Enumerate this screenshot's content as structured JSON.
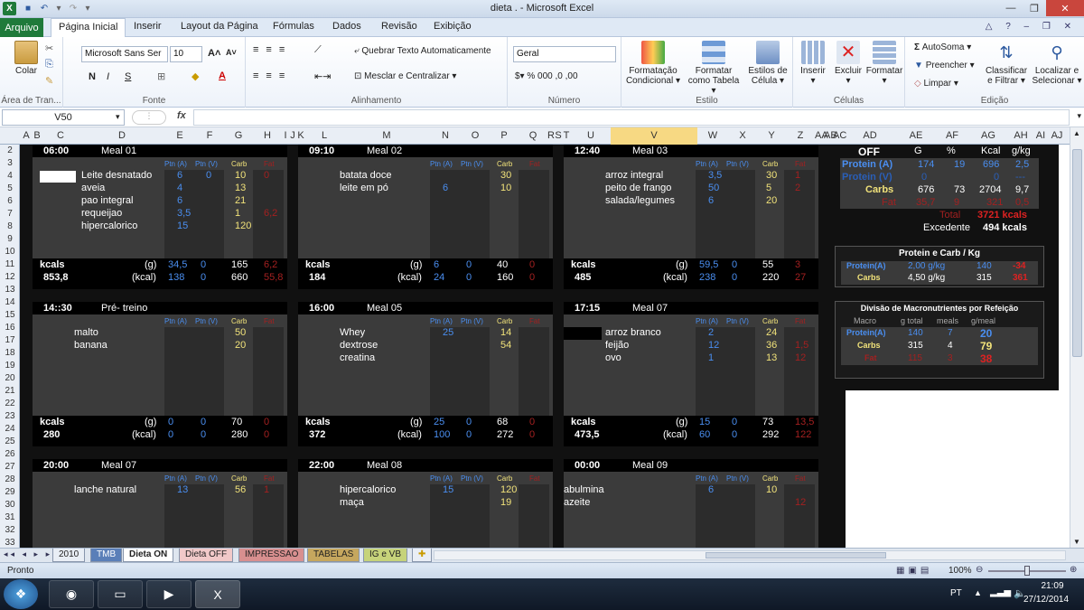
{
  "window": {
    "title": "dieta . - Microsoft Excel"
  },
  "tabs": [
    "Arquivo",
    "Página Inicial",
    "Inserir",
    "Layout da Página",
    "Fórmulas",
    "Dados",
    "Revisão",
    "Exibição"
  ],
  "ribbon": {
    "colar": "Colar",
    "font_name": "Microsoft Sans Ser",
    "font_size": "10",
    "quebrar": "Quebrar Texto Automaticamente",
    "mesclar": "Mesclar e Centralizar",
    "number_format": "Geral",
    "formatacao_condicional": [
      "Formatação",
      "Condicional"
    ],
    "formatar_tabela": [
      "Formatar",
      "como Tabela"
    ],
    "estilos_celula": [
      "Estilos de",
      "Célula"
    ],
    "inserir": "Inserir",
    "excluir": "Excluir",
    "formatar": "Formatar",
    "autosoma": "AutoSoma",
    "preencher": "Preencher",
    "limpar": "Limpar",
    "classificar": [
      "Classificar",
      "e Filtrar"
    ],
    "localizar": [
      "Localizar e",
      "Selecionar"
    ],
    "groups": [
      "Área de Tran...",
      "Fonte",
      "Alinhamento",
      "Número",
      "Estilo",
      "Células",
      "Edição"
    ],
    "bold": "N",
    "italic": "I",
    "underline": "S"
  },
  "formula_bar": {
    "name_box": "V50",
    "fx": "fx",
    "content": ""
  },
  "columns": [
    "A",
    "B",
    "C",
    "D",
    "E",
    "F",
    "G",
    "H",
    "I",
    "J",
    "K",
    "L",
    "M",
    "N",
    "O",
    "P",
    "Q",
    "R",
    "S",
    "T",
    "U",
    "V",
    "W",
    "X",
    "Y",
    "Z",
    "AA",
    "AB",
    "AC",
    "AD",
    "AE",
    "AF",
    "AG",
    "AH",
    "AI",
    "AJ"
  ],
  "rows": [
    "2",
    "3",
    "4",
    "5",
    "6",
    "7",
    "8",
    "9",
    "10",
    "11",
    "12",
    "13",
    "14",
    "15",
    "16",
    "17",
    "18",
    "19",
    "20",
    "21",
    "22",
    "23",
    "24",
    "25",
    "26",
    "27",
    "28",
    "29",
    "30",
    "31",
    "32",
    "33"
  ],
  "meals": [
    {
      "time": "06:00",
      "name": "Meal 01",
      "items": [
        "Leite desnatado",
        "aveia",
        "pao integral",
        "requeijao",
        "hipercalorico"
      ],
      "ptn_a": [
        "6",
        "4",
        "6",
        "3,5",
        "15"
      ],
      "ptn_v": [
        "0",
        "",
        "",
        "",
        ""
      ],
      "carb": [
        "10",
        "13",
        "21",
        "1",
        "120"
      ],
      "fat": [
        "0",
        "",
        "",
        "6,2",
        ""
      ],
      "g": [
        "34,5",
        "0",
        "165",
        "6,2"
      ],
      "kcal": [
        "138",
        "0",
        "660",
        "55,8"
      ],
      "total": "853,8"
    },
    {
      "time": "09:10",
      "name": "Meal 02",
      "items": [
        "batata doce",
        "leite em pó"
      ],
      "ptn_a": [
        "",
        "6"
      ],
      "ptn_v": [
        "",
        ""
      ],
      "carb": [
        "30",
        "10"
      ],
      "fat": [
        "",
        ""
      ],
      "g": [
        "6",
        "0",
        "40",
        "0"
      ],
      "kcal": [
        "24",
        "0",
        "160",
        "0"
      ],
      "total": "184"
    },
    {
      "time": "12:40",
      "name": "Meal 03",
      "items": [
        "arroz integral",
        "peito de frango",
        "salada/legumes"
      ],
      "ptn_a": [
        "3,5",
        "50",
        "6"
      ],
      "ptn_v": [
        "",
        "",
        ""
      ],
      "carb": [
        "30",
        "5",
        "20"
      ],
      "fat": [
        "1",
        "2",
        ""
      ],
      "g": [
        "59,5",
        "0",
        "55",
        "3"
      ],
      "kcal": [
        "238",
        "0",
        "220",
        "27"
      ],
      "total": "485"
    },
    {
      "time": "14::30",
      "name": "Pré- treino",
      "items": [
        "malto",
        "banana"
      ],
      "ptn_a": [
        "",
        ""
      ],
      "ptn_v": [
        "",
        ""
      ],
      "carb": [
        "50",
        "20"
      ],
      "fat": [
        "",
        ""
      ],
      "g": [
        "0",
        "0",
        "70",
        "0"
      ],
      "kcal": [
        "0",
        "0",
        "280",
        "0"
      ],
      "total": "280"
    },
    {
      "time": "16:00",
      "name": "Meal 05",
      "items": [
        "Whey",
        "dextrose",
        "creatina"
      ],
      "ptn_a": [
        "25",
        "",
        ""
      ],
      "ptn_v": [
        "",
        "",
        ""
      ],
      "carb": [
        "14",
        "54",
        ""
      ],
      "fat": [
        "",
        "",
        ""
      ],
      "g": [
        "25",
        "0",
        "68",
        "0"
      ],
      "kcal": [
        "100",
        "0",
        "272",
        "0"
      ],
      "total": "372"
    },
    {
      "time": "17:15",
      "name": "Meal 07",
      "items": [
        "arroz branco",
        "feijão",
        "ovo"
      ],
      "ptn_a": [
        "2",
        "12",
        "1"
      ],
      "ptn_v": [
        "",
        "",
        ""
      ],
      "carb": [
        "24",
        "36",
        "13"
      ],
      "fat": [
        "",
        "1,5",
        "12"
      ],
      "g": [
        "15",
        "0",
        "73",
        "13,5"
      ],
      "kcal": [
        "60",
        "0",
        "292",
        "122"
      ],
      "total": "473,5"
    },
    {
      "time": "20:00",
      "name": "Meal 07",
      "items": [
        "lanche natural"
      ],
      "ptn_a": [
        "13"
      ],
      "ptn_v": [
        ""
      ],
      "carb": [
        "56"
      ],
      "fat": [
        "1"
      ],
      "total": ""
    },
    {
      "time": "22:00",
      "name": "Meal 08",
      "items": [
        "hipercalorico",
        "maça"
      ],
      "ptn_a": [
        "15",
        ""
      ],
      "ptn_v": [
        "",
        ""
      ],
      "carb": [
        "120",
        "19"
      ],
      "fat": [
        "",
        ""
      ],
      "total": ""
    },
    {
      "time": "00:00",
      "name": "Meal 09",
      "items": [
        "abulmina",
        "azeite"
      ],
      "ptn_a": [
        "6",
        ""
      ],
      "ptn_v": [
        "",
        ""
      ],
      "carb": [
        "10",
        ""
      ],
      "fat": [
        "",
        "12"
      ],
      "total": ""
    }
  ],
  "labels": {
    "ptn_a": "Ptn (A)",
    "ptn_v": "Ptn (V)",
    "carb": "Carb",
    "fat": "Fat",
    "kcals": "kcals",
    "g": "(g)",
    "kcal": "(kcal)"
  },
  "summary": {
    "header": [
      "OFF",
      "G",
      "%",
      "Kcal",
      "g/kg"
    ],
    "rows": [
      {
        "label": "Protein (A)",
        "g": "174",
        "pct": "19",
        "kcal": "696",
        "gkg": "2,5"
      },
      {
        "label": "Protein (V)",
        "g": "0",
        "pct": "",
        "kcal": "0",
        "gkg": "---"
      },
      {
        "label": "Carbs",
        "g": "676",
        "pct": "73",
        "kcal": "2704",
        "gkg": "9,7"
      },
      {
        "label": "Fat",
        "g": "35,7",
        "pct": "9",
        "kcal": "321",
        "gkg": "0,5"
      }
    ],
    "total_label": "Total",
    "total_value": "3721 kcals",
    "excedente_label": "Excedente",
    "excedente_value": "494 kcals"
  },
  "protein_carb": {
    "title": "Protein e Carb / Kg",
    "rows": [
      {
        "label": "Protein(A)",
        "val": "2,00 g/kg",
        "n": "140",
        "x": "-34"
      },
      {
        "label": "Carbs",
        "val": "4,50 g/kg",
        "n": "315",
        "x": "361"
      }
    ]
  },
  "divisao": {
    "title": "Divisão de Macronutrientes por Refeição",
    "header": [
      "Macro",
      "g total",
      "meals",
      "g/meal"
    ],
    "rows": [
      {
        "macro": "Protein(A)",
        "g": "140",
        "meals": "7",
        "gm": "20"
      },
      {
        "macro": "Carbs",
        "g": "315",
        "meals": "4",
        "gm": "79"
      },
      {
        "macro": "Fat",
        "g": "115",
        "meals": "3",
        "gm": "38"
      }
    ]
  },
  "sheet_tabs": [
    "2010",
    "TMB",
    "Dieta ON",
    "Dieta OFF",
    "IMPRESSAO",
    "TABELAS",
    "IG e VB"
  ],
  "status": {
    "ready": "Pronto",
    "zoom": "100%"
  },
  "taskbar": {
    "lang": "PT",
    "time": "21:09",
    "date": "27/12/2014"
  }
}
